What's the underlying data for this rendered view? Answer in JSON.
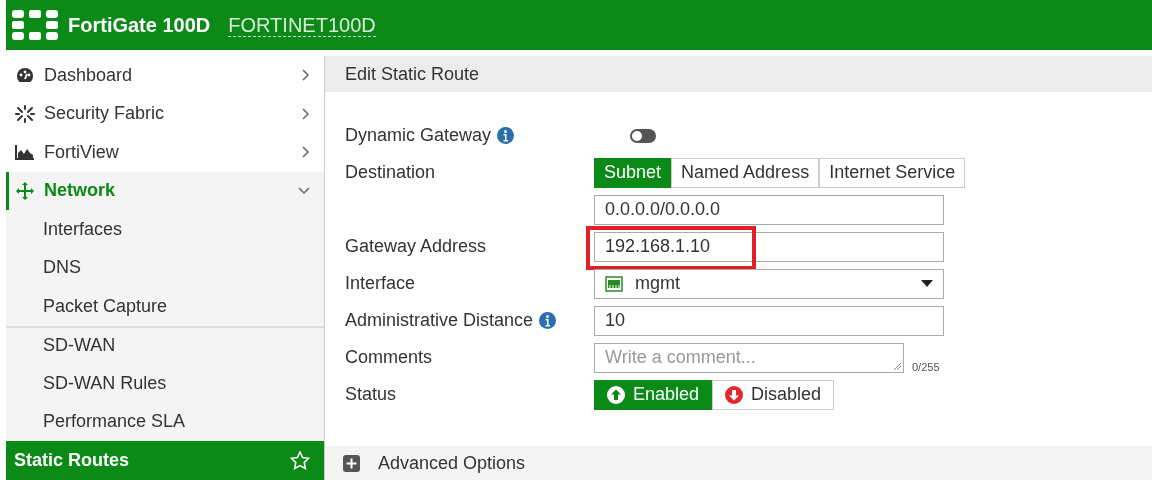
{
  "header": {
    "product": "FortiGate 100D",
    "hostname": "FORTINET100D"
  },
  "sidebar": {
    "items": [
      {
        "label": "Dashboard",
        "expanded": false,
        "selected": false
      },
      {
        "label": "Security Fabric",
        "expanded": false,
        "selected": false
      },
      {
        "label": "FortiView",
        "expanded": false,
        "selected": false
      },
      {
        "label": "Network",
        "expanded": true,
        "selected": true,
        "children": [
          {
            "label": "Interfaces",
            "selected": false,
            "group_start": false
          },
          {
            "label": "DNS",
            "selected": false,
            "group_start": false
          },
          {
            "label": "Packet Capture",
            "selected": false,
            "group_start": false
          },
          {
            "label": "SD-WAN",
            "selected": false,
            "group_start": true
          },
          {
            "label": "SD-WAN Rules",
            "selected": false,
            "group_start": false
          },
          {
            "label": "Performance SLA",
            "selected": false,
            "group_start": false
          },
          {
            "label": "Static Routes",
            "selected": true,
            "group_start": false
          }
        ]
      }
    ]
  },
  "page": {
    "title": "Edit Static Route",
    "rows": [
      {
        "label": "Dynamic Gateway",
        "info": true,
        "kind": "toggle",
        "on": false
      },
      {
        "label": "Destination",
        "info": false,
        "kind": "segmented",
        "options": [
          {
            "label": "Subnet",
            "selected": true
          },
          {
            "label": "Named Address",
            "selected": false
          },
          {
            "label": "Internet Service",
            "selected": false
          }
        ]
      },
      {
        "info": false,
        "kind": "text",
        "value": "0.0.0.0/0.0.0.0",
        "highlighted": false
      },
      {
        "label": "Gateway Address",
        "info": false,
        "kind": "text",
        "value": "192.168.1.10",
        "highlighted": true
      },
      {
        "label": "Interface",
        "info": false,
        "kind": "select",
        "value": "mgmt"
      },
      {
        "label": "Administrative Distance",
        "info": true,
        "kind": "text",
        "value": "10",
        "highlighted": false
      },
      {
        "label": "Comments",
        "info": false,
        "kind": "textarea",
        "placeholder": "Write a comment...",
        "counter": "0/255"
      },
      {
        "label": "Status",
        "info": false,
        "kind": "status",
        "options": [
          {
            "label": "Enabled",
            "selected": true
          },
          {
            "label": "Disabled",
            "selected": false
          }
        ]
      }
    ],
    "advanced": {
      "label": "Advanced Options",
      "expanded": false
    }
  }
}
